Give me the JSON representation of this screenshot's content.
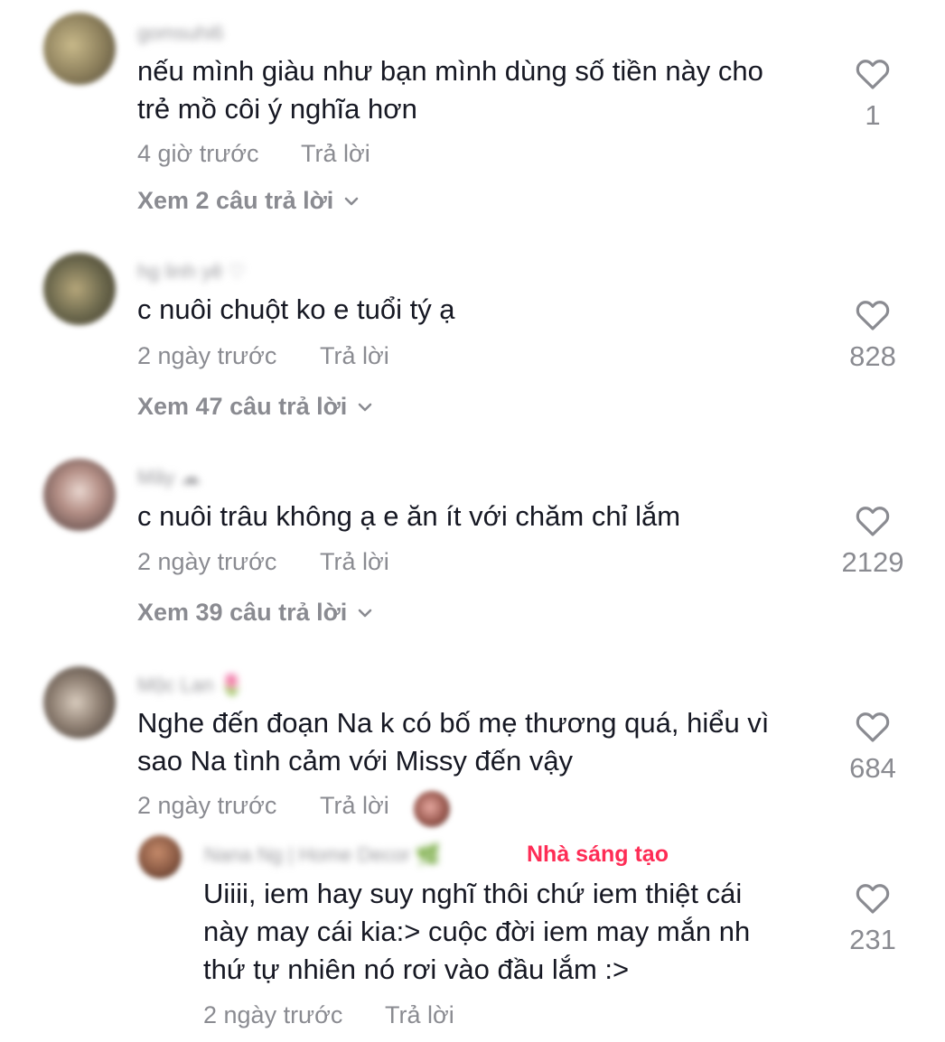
{
  "comments": [
    {
      "username": "gomsuhi6",
      "text_lines": [
        "nếu mình giàu như bạn mình dùng số tiền này cho",
        "trẻ mồ côi ý nghĩa hơn"
      ],
      "time": "4 giờ trước",
      "reply_label": "Trả lời",
      "view_replies": "Xem 2 câu trả lời",
      "likes": "1",
      "avatar_color": "#8a7d5a"
    },
    {
      "username": "hg linh yê ♡",
      "text_lines": [
        "c nuôi chuột ko e tuổi tý ạ"
      ],
      "time": "2 ngày trước",
      "reply_label": "Trả lời",
      "view_replies": "Xem 47 câu trả lời",
      "likes": "828",
      "avatar_color": "#6e6a4e"
    },
    {
      "username": "Mây ☁",
      "text_lines": [
        "c nuôi trâu không ạ e ăn ít với chăm chỉ lắm"
      ],
      "time": "2 ngày trước",
      "reply_label": "Trả lời",
      "view_replies": "Xem 39 câu trả lời",
      "likes": "2129",
      "avatar_color": "#6b5a5a"
    },
    {
      "username": "Mộc Lan 🌷",
      "text_lines": [
        "Nghe đến đoạn Na k có bố mẹ thương quá, hiểu vì",
        "sao Na tình cảm với Missy đến vậy"
      ],
      "time": "2 ngày trước",
      "reply_label": "Trả lời",
      "likes": "684",
      "avatar_color": "#7a6e66"
    }
  ],
  "reply": {
    "username": "Nana Ng | Home Decor 🌿",
    "badge": "Nhà sáng tạo",
    "text_lines": [
      "Uiiii, iem hay suy nghĩ thôi chứ iem thiệt cái",
      "này may cái kia:> cuộc đời iem may mắn nh",
      "thứ tự nhiên nó rơi vào đầu lắm :>"
    ],
    "time": "2 ngày trước",
    "reply_label": "Trả lời",
    "likes": "231",
    "avatar_color": "#8a5a44"
  },
  "colors": {
    "text": "#161823",
    "muted": "#8a8b91",
    "creator_badge": "#fe2c55"
  },
  "icons": {
    "like": "heart-outline-icon",
    "expand": "chevron-down-icon"
  }
}
